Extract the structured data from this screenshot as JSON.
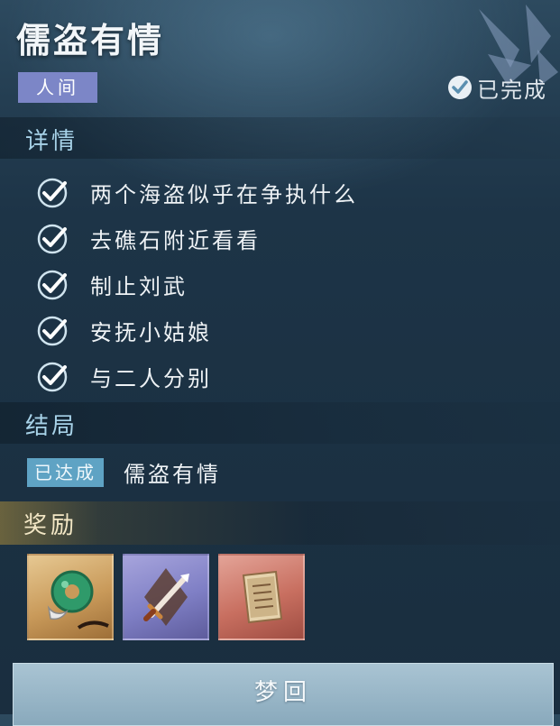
{
  "quest": {
    "title": "儒盗有情",
    "realm_tag": "人间",
    "status_label": "已完成"
  },
  "details": {
    "heading": "详情",
    "tasks": [
      {
        "text": "两个海盗似乎在争执什么",
        "done": true
      },
      {
        "text": "去礁石附近看看",
        "done": true
      },
      {
        "text": "制止刘武",
        "done": true
      },
      {
        "text": "安抚小姑娘",
        "done": true
      },
      {
        "text": "与二人分别",
        "done": true
      }
    ]
  },
  "ending": {
    "heading": "结局",
    "badge": "已达成",
    "name": "儒盗有情"
  },
  "rewards": {
    "heading": "奖励",
    "items": [
      {
        "icon": "jade-pendant-icon",
        "rarity_color": "#d9b47a"
      },
      {
        "icon": "sword-icon",
        "rarity_color": "#8a88cf"
      },
      {
        "icon": "book-icon",
        "rarity_color": "#d4857a"
      }
    ]
  },
  "actions": {
    "dream_button_label": "梦回"
  },
  "colors": {
    "realm_tag": "#7c86c7",
    "ending_badge": "#5fa3c4",
    "section_heading": "#a7d2e8"
  }
}
